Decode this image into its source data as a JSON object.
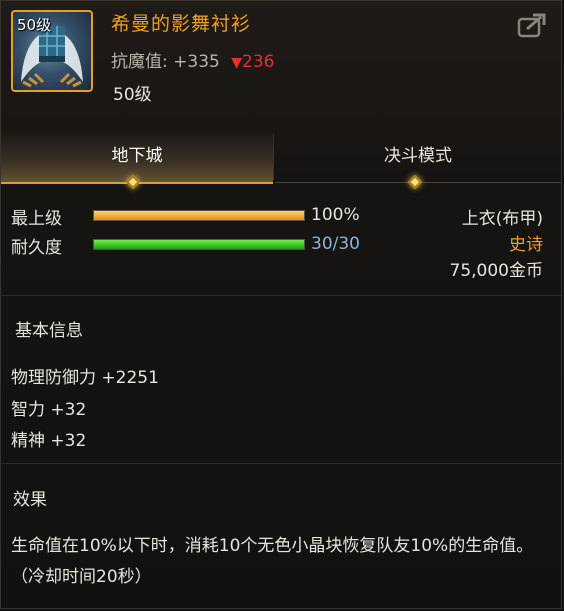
{
  "item": {
    "icon": "winged-shirt-icon",
    "icon_level": "50级",
    "name": "希曼的影舞衬衫",
    "magic_resist_label": "抗魔值: +335",
    "magic_resist_diff": "236",
    "diff_arrow": "▼",
    "level": "50级"
  },
  "share_icon": "share-icon",
  "tabs": [
    {
      "label": "地下城",
      "active": true
    },
    {
      "label": "决斗模式",
      "active": false
    }
  ],
  "stats": {
    "grade_label": "最上级",
    "grade_value": "100%",
    "grade_fraction": 1.0,
    "durability_label": "耐久度",
    "durability_value": "30/30",
    "durability_fraction": 1.0
  },
  "info": {
    "slot": "上衣(布甲)",
    "rarity": "史诗",
    "price": "75,000金币"
  },
  "basic": {
    "title": "基本信息",
    "attrs": [
      "物理防御力 +2251",
      "智力 +32",
      "精神 +32"
    ]
  },
  "effect": {
    "title": "效果",
    "text": "生命值在10%以下时，消耗10个无色小晶块恢复队友10%的生命值。（冷却时间20秒）"
  },
  "colors": {
    "item_name": "#f0a020",
    "rarity": "#f0a020",
    "diff_down": "#e23030",
    "durability_value": "#8fb0d8",
    "accent_border": "#e6a020"
  }
}
